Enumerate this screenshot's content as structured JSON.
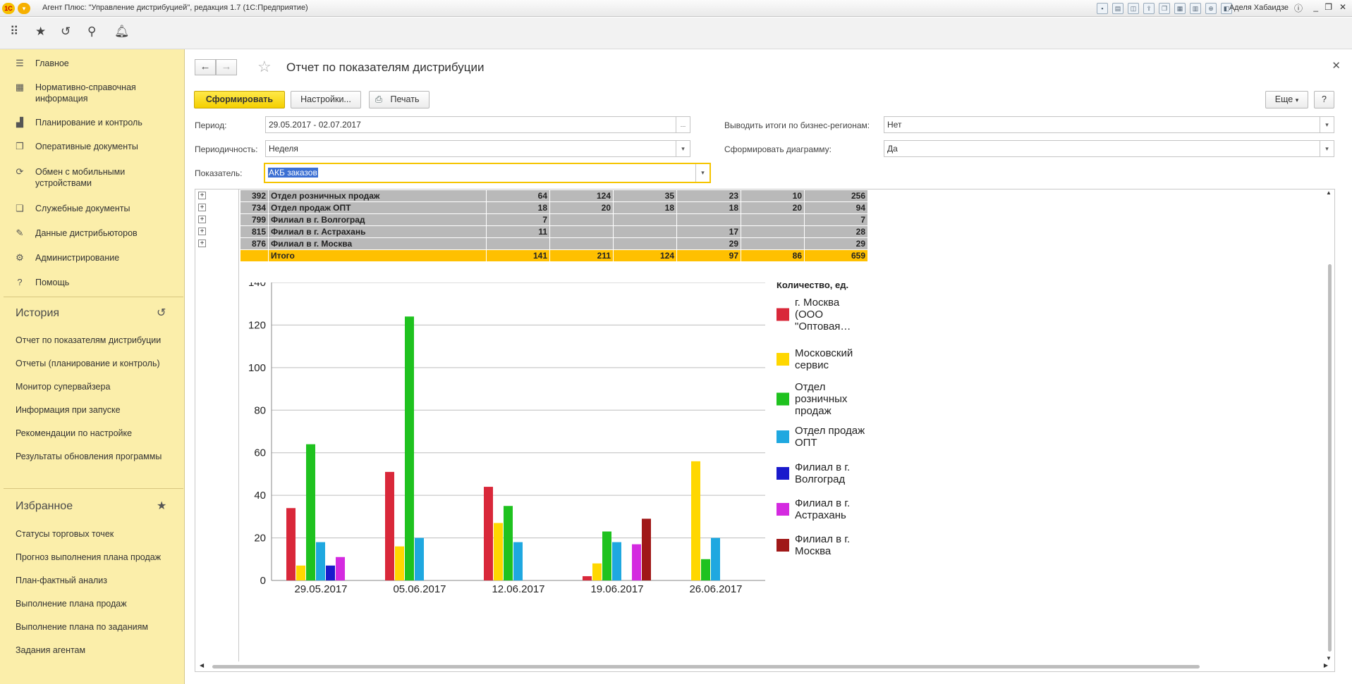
{
  "window": {
    "title": "Агент Плюс: \"Управление дистрибуцией\", редакция 1.7  (1С:Предприятие)",
    "user": "Аделя Хабаидзе"
  },
  "sidebar": {
    "items": [
      {
        "label": "Главное",
        "icon": "menu-icon"
      },
      {
        "label": "Нормативно-справочная информация",
        "icon": "grid-icon"
      },
      {
        "label": "Планирование и контроль",
        "icon": "bar-chart-icon"
      },
      {
        "label": "Оперативные документы",
        "icon": "documents-icon"
      },
      {
        "label": "Обмен с мобильными устройствами",
        "icon": "sync-icon"
      },
      {
        "label": "Служебные документы",
        "icon": "service-docs-icon"
      },
      {
        "label": "Данные дистрибьюторов",
        "icon": "distributor-data-icon"
      },
      {
        "label": "Администрирование",
        "icon": "gear-icon"
      },
      {
        "label": "Помощь",
        "icon": "help-icon"
      }
    ],
    "history_title": "История",
    "history": [
      "Отчет по показателям дистрибуции",
      "Отчеты (планирование и контроль)",
      "Монитор супервайзера",
      "Информация при запуске",
      "Рекомендации по настройке",
      "Результаты обновления программы"
    ],
    "favorites_title": "Избранное",
    "favorites": [
      "Статусы торговых точек",
      "Прогноз выполнения плана продаж",
      "План-фактный анализ",
      "Выполнение плана продаж",
      "Выполнение плана по заданиям",
      "Задания агентам"
    ]
  },
  "page": {
    "title": "Отчет по показателям дистрибуции",
    "btn_generate": "Сформировать",
    "btn_settings": "Настройки...",
    "btn_print": "Печать",
    "btn_more": "Еще",
    "btn_help": "?"
  },
  "form": {
    "period_label": "Период:",
    "period_value": "29.05.2017 - 02.07.2017",
    "period_btn": "...",
    "periodicity_label": "Периодичность:",
    "periodicity_value": "Неделя",
    "indicator_label": "Показатель:",
    "indicator_value": "АКБ заказов",
    "totals_label": "Выводить итоги по бизнес-регионам:",
    "totals_value": "Нет",
    "diagram_label": "Сформировать диаграмму:",
    "diagram_value": "Да"
  },
  "table": {
    "rows": [
      {
        "code": "392",
        "name": "Отдел розничных продаж",
        "v": [
          "64",
          "124",
          "35",
          "23",
          "10",
          "256"
        ]
      },
      {
        "code": "734",
        "name": "Отдел продаж ОПТ",
        "v": [
          "18",
          "20",
          "18",
          "18",
          "20",
          "94"
        ]
      },
      {
        "code": "799",
        "name": "Филиал в г. Волгоград",
        "v": [
          "7",
          "",
          "",
          "",
          "",
          "7"
        ]
      },
      {
        "code": "815",
        "name": "Филиал в г. Астрахань",
        "v": [
          "11",
          "",
          "",
          "17",
          "",
          "28"
        ]
      },
      {
        "code": "876",
        "name": "Филиал в г. Москва",
        "v": [
          "",
          "",
          "",
          "29",
          "",
          "29"
        ]
      }
    ],
    "total": {
      "name": "Итого",
      "v": [
        "141",
        "211",
        "124",
        "97",
        "86",
        "659"
      ]
    }
  },
  "chart_data": {
    "type": "bar",
    "categories": [
      "29.05.2017",
      "05.06.2017",
      "12.06.2017",
      "19.06.2017",
      "26.06.2017"
    ],
    "ylim": [
      0,
      140
    ],
    "yticks": [
      "0",
      "20",
      "40",
      "60",
      "80",
      "100",
      "120",
      "140"
    ],
    "legend_title": "Количество, ед.",
    "legend_position": "right",
    "grid": true,
    "series": [
      {
        "name": "г. Москва (ООО \"Оптовая…",
        "legend_lines": [
          "г. Москва",
          "(ООО",
          "\"Оптовая…"
        ],
        "color": "#d9283a",
        "values": [
          34,
          51,
          44,
          2,
          0
        ]
      },
      {
        "name": "Московский сервис",
        "legend_lines": [
          "Московский",
          "сервис"
        ],
        "color": "#ffd700",
        "values": [
          7,
          16,
          27,
          8,
          56
        ]
      },
      {
        "name": "Отдел розничных продаж",
        "legend_lines": [
          "Отдел",
          "розничных",
          "продаж"
        ],
        "color": "#1fc21f",
        "values": [
          64,
          124,
          35,
          23,
          10
        ]
      },
      {
        "name": "Отдел продаж ОПТ",
        "legend_lines": [
          "Отдел продаж",
          "ОПТ"
        ],
        "color": "#1fa8e0",
        "values": [
          18,
          20,
          18,
          18,
          20
        ]
      },
      {
        "name": "Филиал в г. Волгоград",
        "legend_lines": [
          "Филиал в г.",
          "Волгоград"
        ],
        "color": "#1a1acc",
        "values": [
          7,
          0,
          0,
          0,
          0
        ]
      },
      {
        "name": "Филиал в г. Астрахань",
        "legend_lines": [
          "Филиал в г.",
          "Астрахань"
        ],
        "color": "#d42ae0",
        "values": [
          11,
          0,
          0,
          17,
          0
        ]
      },
      {
        "name": "Филиал в г. Москва",
        "legend_lines": [
          "Филиал в г.",
          "Москва"
        ],
        "color": "#a01818",
        "values": [
          0,
          0,
          0,
          29,
          0
        ]
      }
    ]
  }
}
